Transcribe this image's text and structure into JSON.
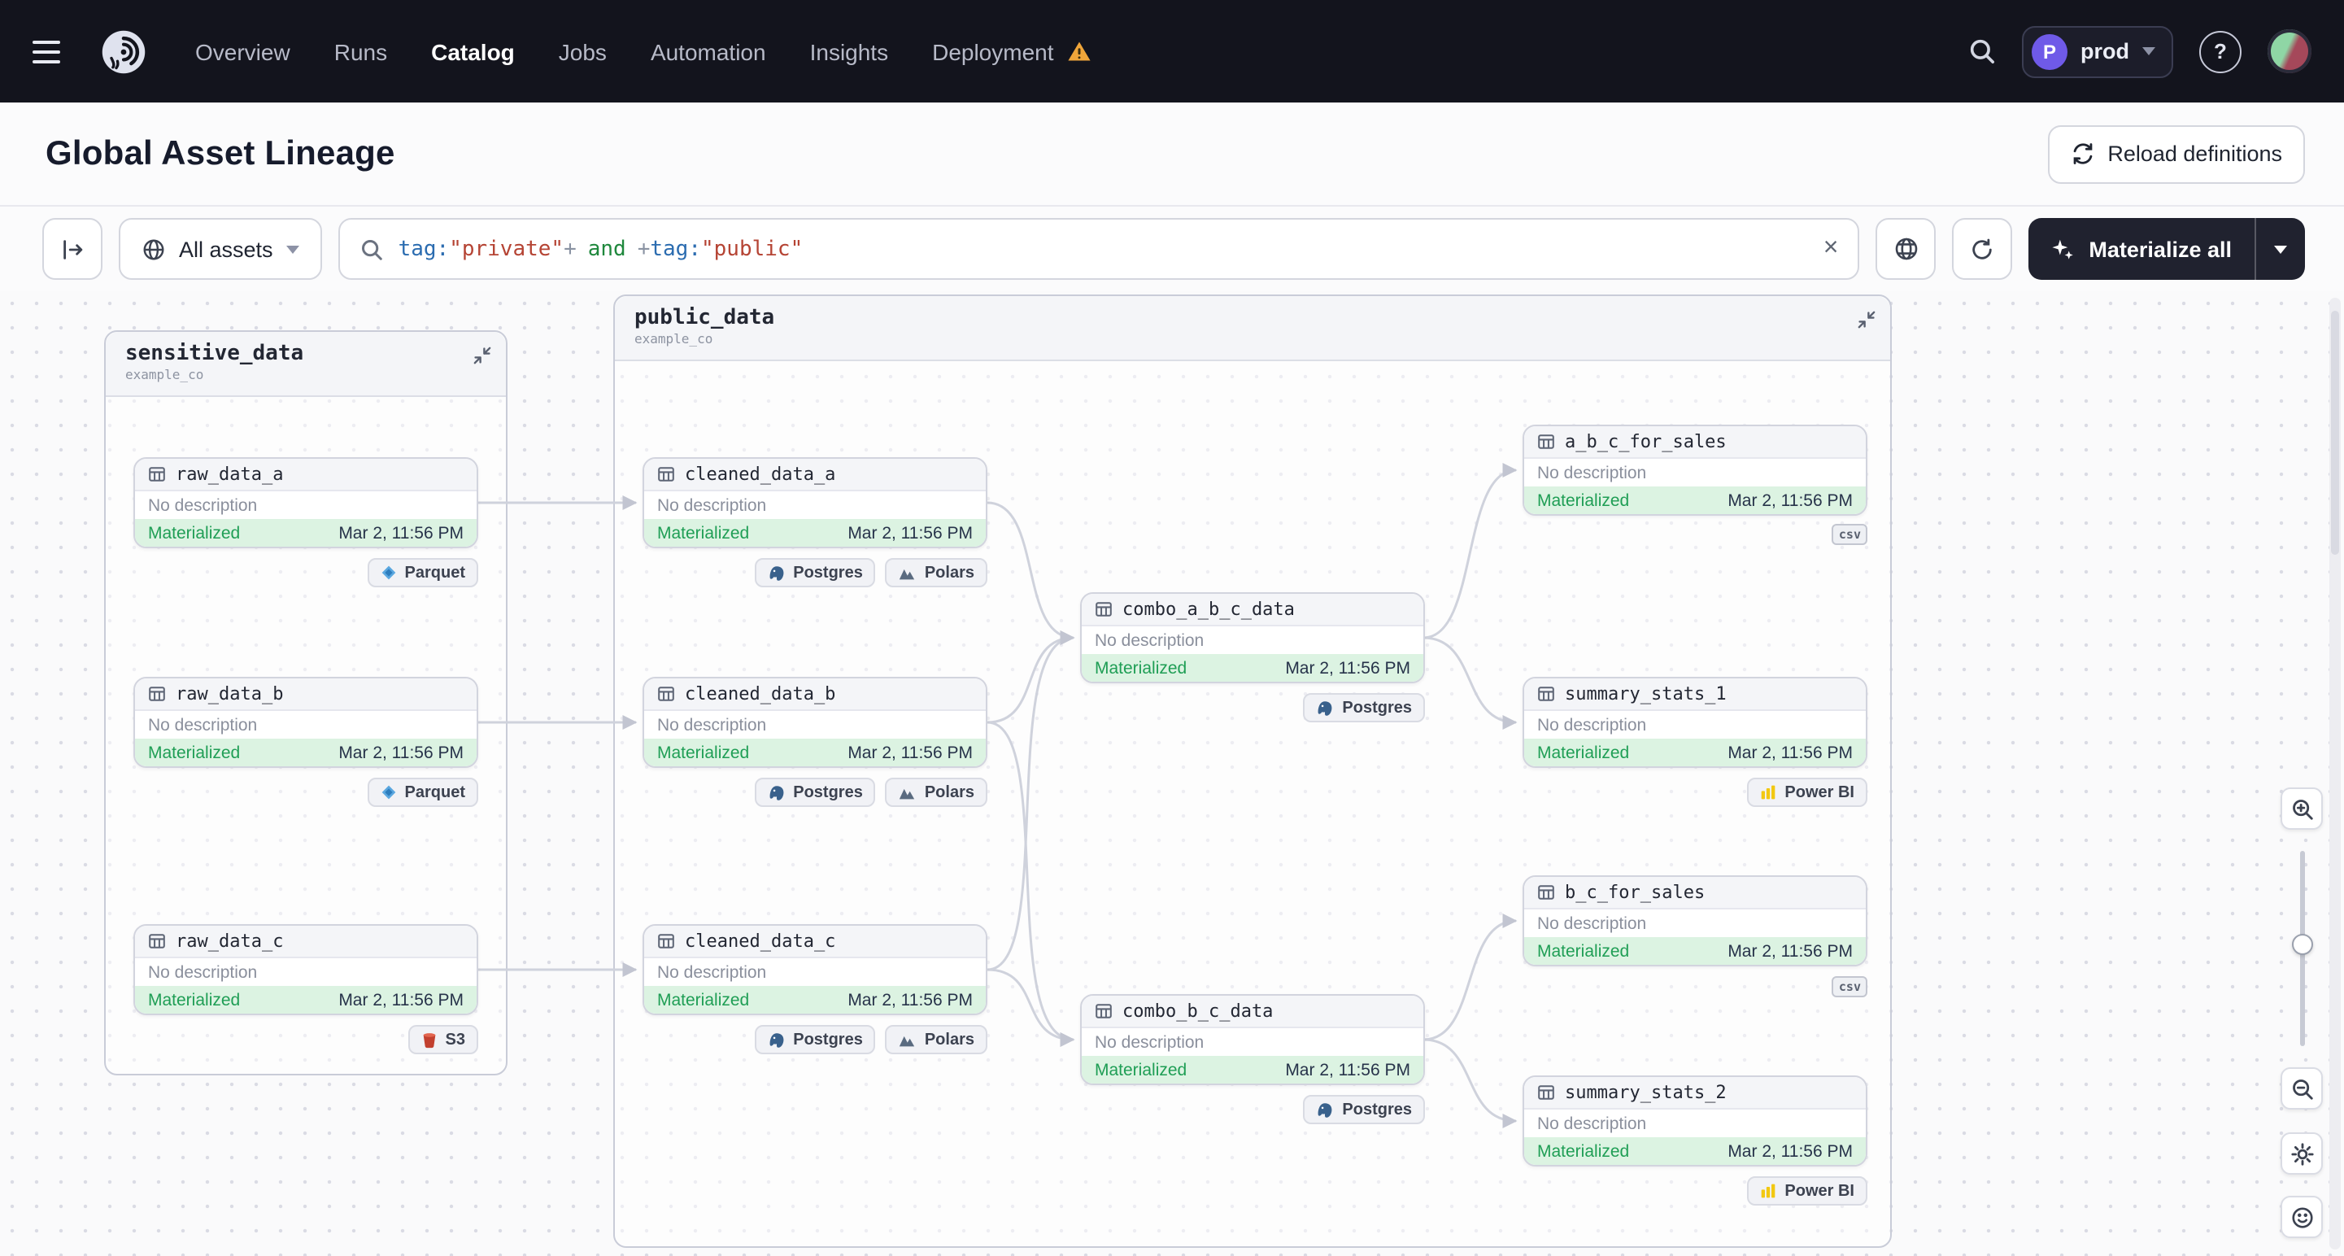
{
  "colors": {
    "navbar_bg": "#13141d",
    "status_green_bg": "#dcf3e2",
    "status_green_text": "#1f9e55",
    "warning_amber": "#F1A63A",
    "env_avatar_purple": "#6f5ae8"
  },
  "icons": {
    "clear": "×",
    "help": "?"
  },
  "nav": {
    "menu_items": [
      {
        "label": "Overview"
      },
      {
        "label": "Runs"
      },
      {
        "label": "Catalog"
      },
      {
        "label": "Jobs"
      },
      {
        "label": "Automation"
      },
      {
        "label": "Insights"
      },
      {
        "label": "Deployment"
      }
    ],
    "active_item": "Catalog",
    "deployment_env": {
      "initial": "P",
      "name": "prod"
    }
  },
  "page": {
    "title": "Global Asset Lineage",
    "reload_button": "Reload definitions"
  },
  "toolbar": {
    "scope_selector": "All assets",
    "selection_query": {
      "fn1": "tag:",
      "str1": "\"private\"",
      "plus1": "+",
      "op": "and",
      "plus2": "+",
      "fn2": "tag:",
      "str2": "\"public\""
    },
    "materialize_button": "Materialize all"
  },
  "groups": {
    "sensitive_data": {
      "name": "sensitive_data",
      "repo": "example_co"
    },
    "public_data": {
      "name": "public_data",
      "repo": "example_co"
    }
  },
  "node_common": {
    "description": "No description",
    "status": "Materialized",
    "timestamp": "Mar 2, 11:56 PM"
  },
  "nodes": {
    "raw_data_a": {
      "name": "raw_data_a"
    },
    "raw_data_b": {
      "name": "raw_data_b"
    },
    "raw_data_c": {
      "name": "raw_data_c"
    },
    "cleaned_data_a": {
      "name": "cleaned_data_a"
    },
    "cleaned_data_b": {
      "name": "cleaned_data_b"
    },
    "cleaned_data_c": {
      "name": "cleaned_data_c"
    },
    "combo_a_b_c_data": {
      "name": "combo_a_b_c_data"
    },
    "combo_b_c_data": {
      "name": "combo_b_c_data"
    },
    "a_b_c_for_sales": {
      "name": "a_b_c_for_sales"
    },
    "summary_stats_1": {
      "name": "summary_stats_1"
    },
    "b_c_for_sales": {
      "name": "b_c_for_sales"
    },
    "summary_stats_2": {
      "name": "summary_stats_2"
    }
  },
  "kind_tags": {
    "parquet": "Parquet",
    "s3": "S3",
    "postgres": "Postgres",
    "polars": "Polars",
    "powerbi": "Power BI",
    "csv": "csv"
  }
}
